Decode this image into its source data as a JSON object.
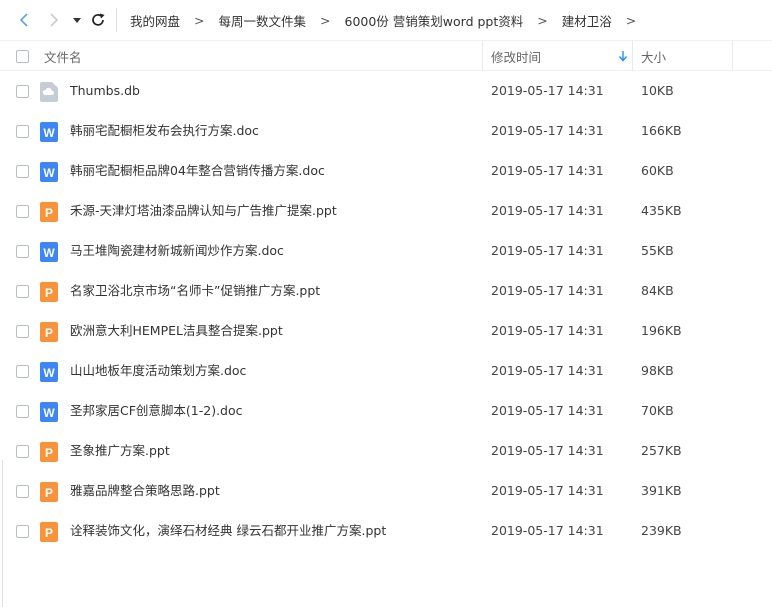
{
  "toolbar": {
    "breadcrumb": [
      "我的网盘",
      "每周一数文件集",
      "6000份 营销策划word ppt资料",
      "建材卫浴"
    ],
    "separator": ">"
  },
  "header": {
    "name_label": "文件名",
    "date_label": "修改时间",
    "size_label": "大小"
  },
  "files": [
    {
      "name": "Thumbs.db",
      "date": "2019-05-17 14:31",
      "size": "10KB",
      "icon": "cloud-file-icon"
    },
    {
      "name": "韩丽宅配橱柜发布会执行方案.doc",
      "date": "2019-05-17 14:31",
      "size": "166KB",
      "icon": "word-doc-icon"
    },
    {
      "name": "韩丽宅配橱柜品牌04年整合营销传播方案.doc",
      "date": "2019-05-17 14:31",
      "size": "60KB",
      "icon": "word-doc-icon"
    },
    {
      "name": "禾源-天津灯塔油漆品牌认知与广告推广提案.ppt",
      "date": "2019-05-17 14:31",
      "size": "435KB",
      "icon": "ppt-icon"
    },
    {
      "name": "马王堆陶瓷建材新城新闻炒作方案.doc",
      "date": "2019-05-17 14:31",
      "size": "55KB",
      "icon": "word-doc-icon"
    },
    {
      "name": "名家卫浴北京市场“名师卡”促销推广方案.ppt",
      "date": "2019-05-17 14:31",
      "size": "84KB",
      "icon": "ppt-icon"
    },
    {
      "name": "欧洲意大利HEMPEL洁具整合提案.ppt",
      "date": "2019-05-17 14:31",
      "size": "196KB",
      "icon": "ppt-icon"
    },
    {
      "name": "山山地板年度活动策划方案.doc",
      "date": "2019-05-17 14:31",
      "size": "98KB",
      "icon": "word-doc-icon"
    },
    {
      "name": "圣邦家居CF创意脚本(1-2).doc",
      "date": "2019-05-17 14:31",
      "size": "70KB",
      "icon": "word-doc-icon"
    },
    {
      "name": "圣象推广方案.ppt",
      "date": "2019-05-17 14:31",
      "size": "257KB",
      "icon": "ppt-icon"
    },
    {
      "name": "雅嘉品牌整合策略思路.ppt",
      "date": "2019-05-17 14:31",
      "size": "391KB",
      "icon": "ppt-icon"
    },
    {
      "name": "诠释装饰文化，演绎石材经典 绿云石都开业推广方案.ppt",
      "date": "2019-05-17 14:31",
      "size": "239KB",
      "icon": "ppt-icon"
    }
  ],
  "colors": {
    "accent": "#1e8eff",
    "word": "#3d86f5",
    "ppt": "#f7943b",
    "cloud": "#c4ccd6",
    "nav_active": "#5aa4f0",
    "nav_disabled": "#c7ccd3"
  }
}
